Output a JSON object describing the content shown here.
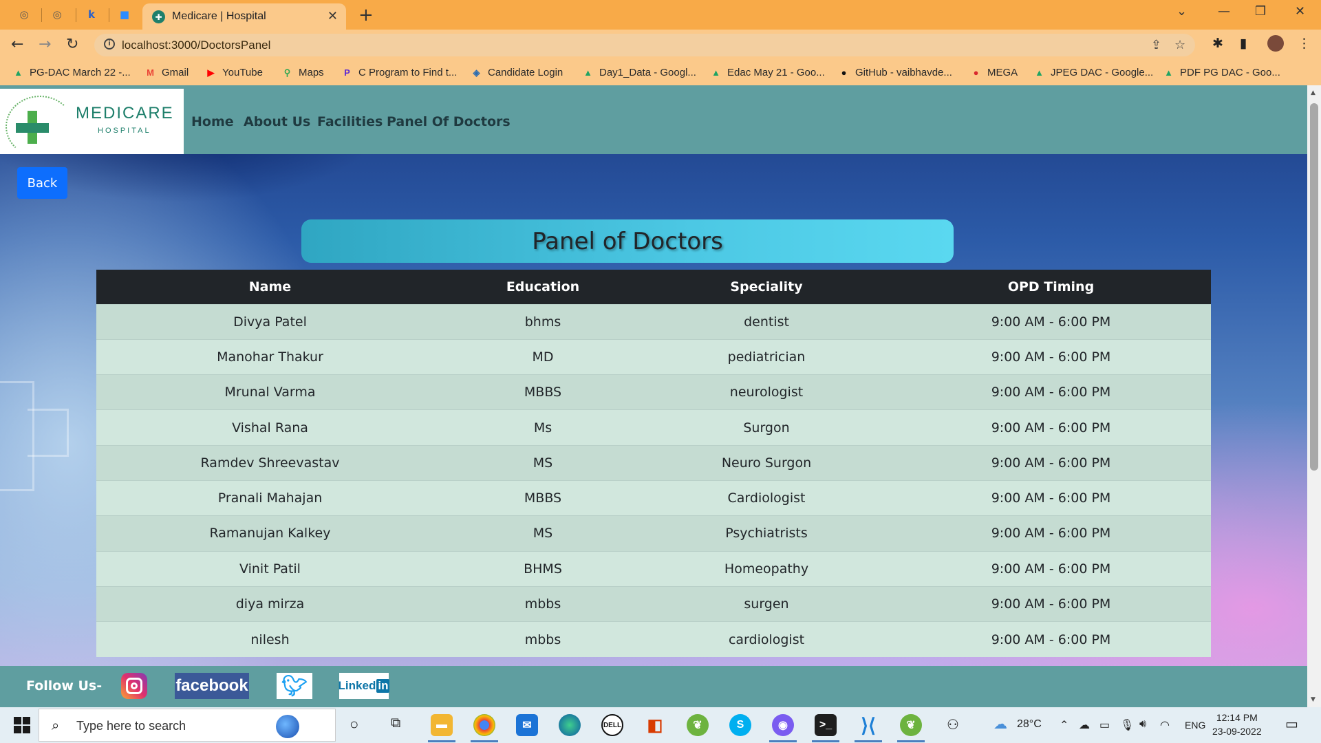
{
  "browser": {
    "active_tab_title": "Medicare | Hospital",
    "url": "localhost:3000/DoctorsPanel",
    "bookmarks": [
      {
        "label": "PG-DAC March 22 -...",
        "icon": "google-drive-icon"
      },
      {
        "label": "Gmail",
        "icon": "gmail-icon"
      },
      {
        "label": "YouTube",
        "icon": "youtube-icon"
      },
      {
        "label": "Maps",
        "icon": "maps-icon"
      },
      {
        "label": "C Program to Find t...",
        "icon": "bookmark-icon"
      },
      {
        "label": "Candidate Login",
        "icon": "bookmark-icon"
      },
      {
        "label": "Day1_Data - Googl...",
        "icon": "google-drive-icon"
      },
      {
        "label": "Edac May 21 - Goo...",
        "icon": "google-drive-icon"
      },
      {
        "label": "GitHub - vaibhavde...",
        "icon": "github-icon"
      },
      {
        "label": "MEGA",
        "icon": "mega-icon"
      },
      {
        "label": "JPEG DAC - Google...",
        "icon": "google-drive-icon"
      },
      {
        "label": "PDF PG DAC - Goo...",
        "icon": "google-drive-icon"
      }
    ]
  },
  "site": {
    "logo_text": "MEDICARE",
    "logo_subtext": "HOSPITAL",
    "logo_ring_text": "HEALING HANDS CARING HEARTS",
    "nav": [
      "Home",
      "About Us",
      "Facilities",
      "Panel Of Doctors"
    ],
    "back_label": "Back",
    "heading": "Panel of Doctors",
    "table": {
      "columns": [
        "Name",
        "Education",
        "Speciality",
        "OPD Timing"
      ],
      "rows": [
        [
          "Divya Patel",
          "bhms",
          "dentist",
          "9:00 AM - 6:00 PM"
        ],
        [
          "Manohar Thakur",
          "MD",
          "pediatrician",
          "9:00 AM - 6:00 PM"
        ],
        [
          "Mrunal Varma",
          "MBBS",
          "neurologist",
          "9:00 AM - 6:00 PM"
        ],
        [
          "Vishal Rana",
          "Ms",
          "Surgon",
          "9:00 AM - 6:00 PM"
        ],
        [
          "Ramdev Shreevastav",
          "MS",
          "Neuro Surgon",
          "9:00 AM - 6:00 PM"
        ],
        [
          "Pranali Mahajan",
          "MBBS",
          "Cardiologist",
          "9:00 AM - 6:00 PM"
        ],
        [
          "Ramanujan Kalkey",
          "MS",
          "Psychiatrists",
          "9:00 AM - 6:00 PM"
        ],
        [
          "Vinit Patil",
          "BHMS",
          "Homeopathy",
          "9:00 AM - 6:00 PM"
        ],
        [
          "diya mirza",
          "mbbs",
          "surgen",
          "9:00 AM - 6:00 PM"
        ],
        [
          "nilesh",
          "mbbs",
          "cardiologist",
          "9:00 AM - 6:00 PM"
        ]
      ]
    },
    "footer": {
      "follow_label": "Follow Us-",
      "facebook_label": "facebook",
      "linkedin_label": "Linked",
      "linkedin_badge": "in"
    }
  },
  "taskbar": {
    "search_placeholder": "Type here to search",
    "temperature": "28°C",
    "language": "ENG",
    "time": "12:14 PM",
    "date": "23-09-2022"
  }
}
